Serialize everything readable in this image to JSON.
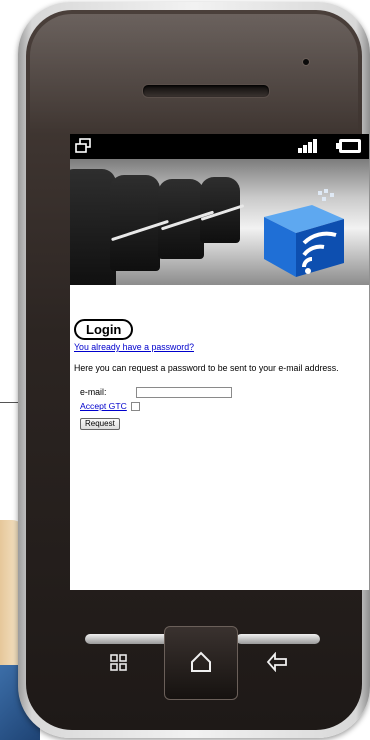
{
  "screen": {
    "login_label": "Login",
    "password_link": "You already have a password?",
    "info_text": "Here you can request a password to be sent to your e-mail address.",
    "form": {
      "email_label": "e-mail:",
      "email_value": "",
      "gtc_link": "Accept GTC",
      "gtc_checked": false,
      "request_label": "Request"
    }
  },
  "status_bar": {
    "icons": [
      "windows-icon",
      "signal-icon",
      "battery-icon"
    ]
  },
  "hardware_keys": [
    "menu-grid-icon",
    "home-icon",
    "back-icon"
  ],
  "colors": {
    "link": "#0000cc",
    "banner_accent": "#1f6fd6",
    "phone_body": "#2c2522"
  }
}
